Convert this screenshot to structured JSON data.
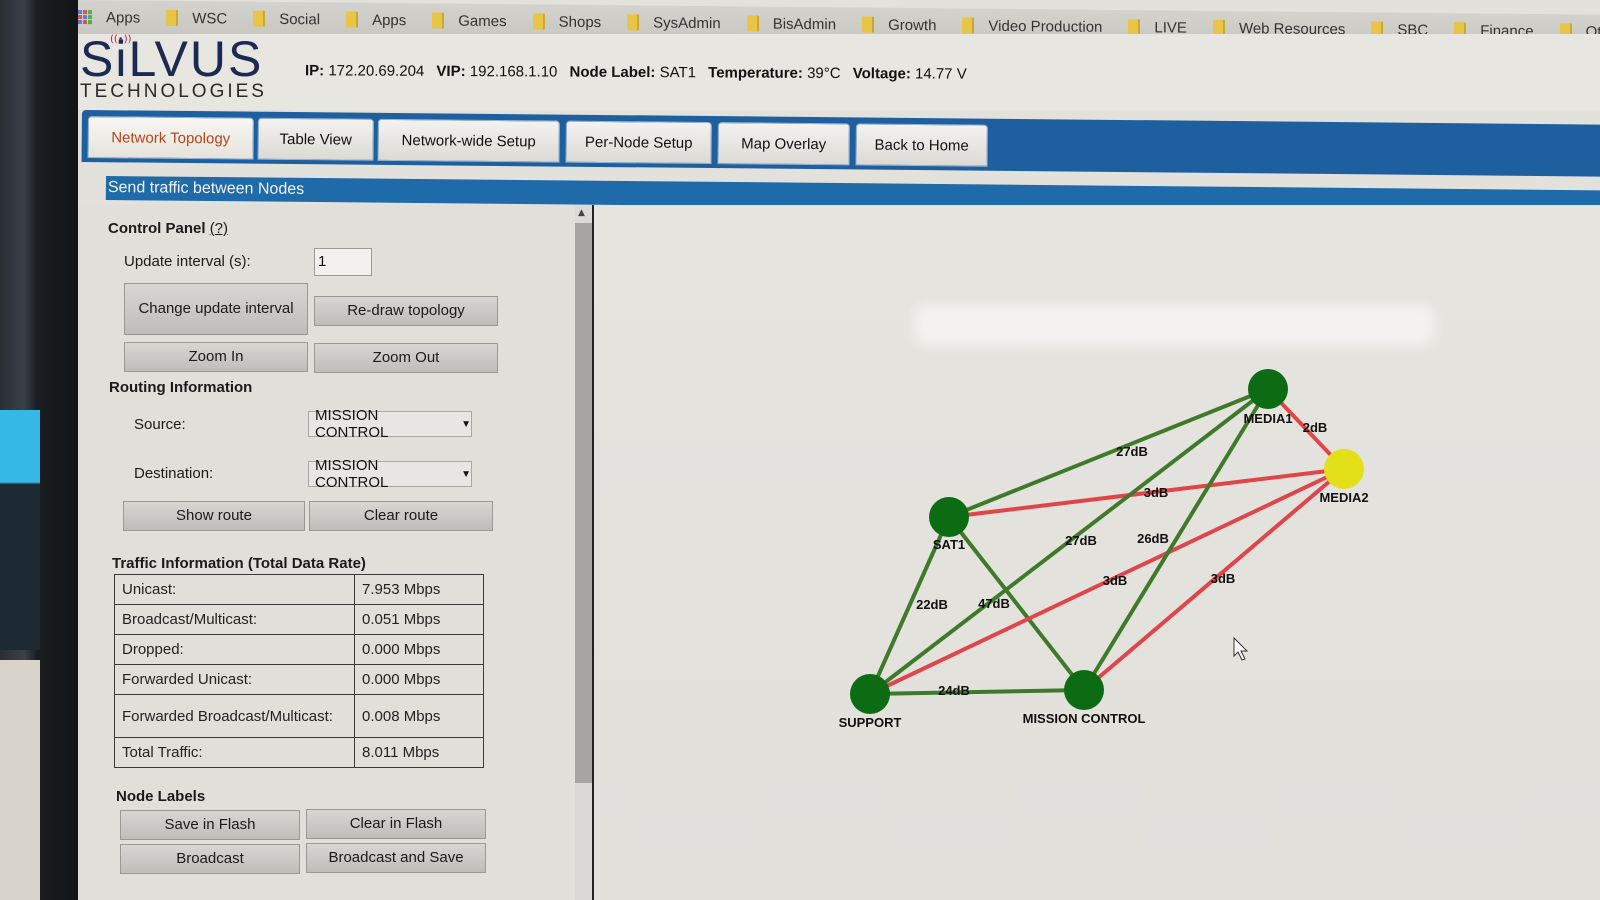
{
  "bookmarks": [
    {
      "label": "Apps",
      "icon": "apps-grid-icon"
    },
    {
      "label": "WSC",
      "icon": "folder-icon"
    },
    {
      "label": "Social",
      "icon": "folder-icon"
    },
    {
      "label": "Apps",
      "icon": "folder-icon"
    },
    {
      "label": "Games",
      "icon": "folder-icon"
    },
    {
      "label": "Shops",
      "icon": "folder-icon"
    },
    {
      "label": "SysAdmin",
      "icon": "folder-icon"
    },
    {
      "label": "BisAdmin",
      "icon": "folder-icon"
    },
    {
      "label": "Growth",
      "icon": "folder-icon"
    },
    {
      "label": "Video Production",
      "icon": "folder-icon"
    },
    {
      "label": "LIVE",
      "icon": "folder-icon"
    },
    {
      "label": "Web Resources",
      "icon": "folder-icon"
    },
    {
      "label": "SBC",
      "icon": "folder-icon"
    },
    {
      "label": "Finance",
      "icon": "folder-icon"
    },
    {
      "label": "Other",
      "icon": "folder-icon"
    }
  ],
  "logo": {
    "main": "SiLVUS",
    "sub": "TECHNOLOGIES"
  },
  "status": {
    "ip_label": "IP:",
    "ip": "172.20.69.204",
    "vip_label": "VIP:",
    "vip": "192.168.1.10",
    "node_label_label": "Node Label:",
    "node_label": "SAT1",
    "temperature_label": "Temperature:",
    "temperature": "39°C",
    "voltage_label": "Voltage:",
    "voltage": "14.77 V"
  },
  "tabs": [
    {
      "label": "Network Topology",
      "active": true
    },
    {
      "label": "Table View"
    },
    {
      "label": "Network-wide Setup"
    },
    {
      "label": "Per-Node Setup"
    },
    {
      "label": "Map Overlay"
    },
    {
      "label": "Back to Home"
    }
  ],
  "section_bar": "Send traffic between Nodes",
  "control_panel": {
    "title": "Control Panel",
    "help": "(?)",
    "update_interval_label": "Update interval (s):",
    "update_interval_value": "1",
    "change_update_interval": "Change update interval",
    "redraw_topology": "Re-draw topology",
    "zoom_in": "Zoom In",
    "zoom_out": "Zoom Out"
  },
  "routing": {
    "title": "Routing Information",
    "source_label": "Source:",
    "source_value": "MISSION CONTROL",
    "destination_label": "Destination:",
    "destination_value": "MISSION CONTROL",
    "show_route": "Show route",
    "clear_route": "Clear route"
  },
  "traffic": {
    "title": "Traffic Information (Total Data Rate)",
    "rows": [
      {
        "label": "Unicast:",
        "value": "7.953 Mbps"
      },
      {
        "label": "Broadcast/Multicast:",
        "value": "0.051 Mbps"
      },
      {
        "label": "Dropped:",
        "value": "0.000 Mbps"
      },
      {
        "label": "Forwarded Unicast:",
        "value": "0.000 Mbps"
      },
      {
        "label": "Forwarded Broadcast/Multicast:",
        "value": "0.008 Mbps"
      },
      {
        "label": "Total Traffic:",
        "value": "8.011 Mbps"
      }
    ]
  },
  "node_labels": {
    "title": "Node Labels",
    "save_in_flash": "Save in Flash",
    "clear_in_flash": "Clear in Flash",
    "broadcast": "Broadcast",
    "broadcast_and_save": "Broadcast and Save"
  },
  "topology": {
    "colors": {
      "good_link": "#3f7a2a",
      "poor_link": "#e0454a",
      "node": "#0d6b14",
      "selected_node": "#e3e01a"
    },
    "nodes": [
      {
        "id": "SAT1",
        "label": "SAT1",
        "color": "node"
      },
      {
        "id": "MEDIA1",
        "label": "MEDIA1",
        "color": "node"
      },
      {
        "id": "MEDIA2",
        "label": "MEDIA2",
        "color": "selected_node"
      },
      {
        "id": "SUPPORT",
        "label": "SUPPORT",
        "color": "node"
      },
      {
        "id": "MISSION_CONTROL",
        "label": "MISSION CONTROL",
        "color": "node"
      }
    ],
    "links": [
      {
        "from": "SAT1",
        "to": "MEDIA1",
        "snr": "27dB",
        "quality": "good_link"
      },
      {
        "from": "SAT1",
        "to": "MEDIA2",
        "snr": "3dB",
        "quality": "poor_link"
      },
      {
        "from": "SAT1",
        "to": "SUPPORT",
        "snr": "22dB",
        "quality": "good_link"
      },
      {
        "from": "SAT1",
        "to": "MISSION_CONTROL",
        "snr": "47dB",
        "quality": "good_link"
      },
      {
        "from": "SUPPORT",
        "to": "MEDIA1",
        "snr": "27dB",
        "quality": "good_link"
      },
      {
        "from": "SUPPORT",
        "to": "MEDIA2",
        "snr": "3dB",
        "quality": "poor_link"
      },
      {
        "from": "SUPPORT",
        "to": "MISSION_CONTROL",
        "snr": "24dB",
        "quality": "good_link"
      },
      {
        "from": "MISSION_CONTROL",
        "to": "MEDIA1",
        "snr": "26dB",
        "quality": "good_link"
      },
      {
        "from": "MISSION_CONTROL",
        "to": "MEDIA2",
        "snr": "3dB",
        "quality": "poor_link"
      },
      {
        "from": "MEDIA1",
        "to": "MEDIA2",
        "snr": "2dB",
        "quality": "poor_link"
      }
    ]
  }
}
